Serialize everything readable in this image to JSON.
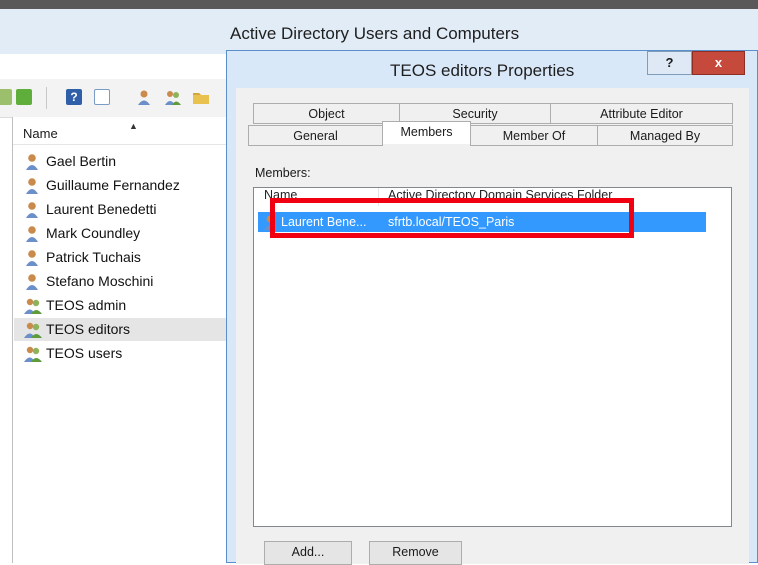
{
  "app": {
    "title": "Active Directory Users and Computers"
  },
  "colors": {
    "titlebar": "#e1ecf6",
    "dialog_frame": "#d9e8f8",
    "selection": "#3399ff",
    "close_button": "#c64a3c",
    "annotation": "#f00010"
  },
  "toolbar": {
    "icons": [
      "import-icon",
      "export-icon",
      "help-icon",
      "view-icon",
      "new-user-icon",
      "new-group-icon",
      "new-folder-icon"
    ]
  },
  "list": {
    "column_header": "Name",
    "items": [
      {
        "label": "Gael Bertin",
        "icon": "user-icon"
      },
      {
        "label": "Guillaume Fernandez",
        "icon": "user-icon"
      },
      {
        "label": "Laurent Benedetti",
        "icon": "user-icon"
      },
      {
        "label": "Mark Coundley",
        "icon": "user-icon"
      },
      {
        "label": "Patrick Tuchais",
        "icon": "user-icon"
      },
      {
        "label": "Stefano Moschini",
        "icon": "user-icon"
      },
      {
        "label": "TEOS admin",
        "icon": "group-icon"
      },
      {
        "label": "TEOS editors",
        "icon": "group-icon",
        "selected": true
      },
      {
        "label": "TEOS users",
        "icon": "group-icon"
      }
    ]
  },
  "dialog": {
    "title": "TEOS editors Properties",
    "help_label": "?",
    "close_label": "x",
    "tabs_back_row": [
      "Object",
      "Security",
      "Attribute Editor"
    ],
    "tabs_front_row": [
      "General",
      "Members",
      "Member Of",
      "Managed By"
    ],
    "active_tab": "Members",
    "members_label": "Members:",
    "columns": [
      "Name",
      "Active Directory Domain Services Folder"
    ],
    "members": [
      {
        "name": "Laurent Bene...",
        "folder": "sfrtb.local/TEOS_Paris"
      }
    ],
    "add_button": "Add...",
    "remove_button": "Remove"
  }
}
